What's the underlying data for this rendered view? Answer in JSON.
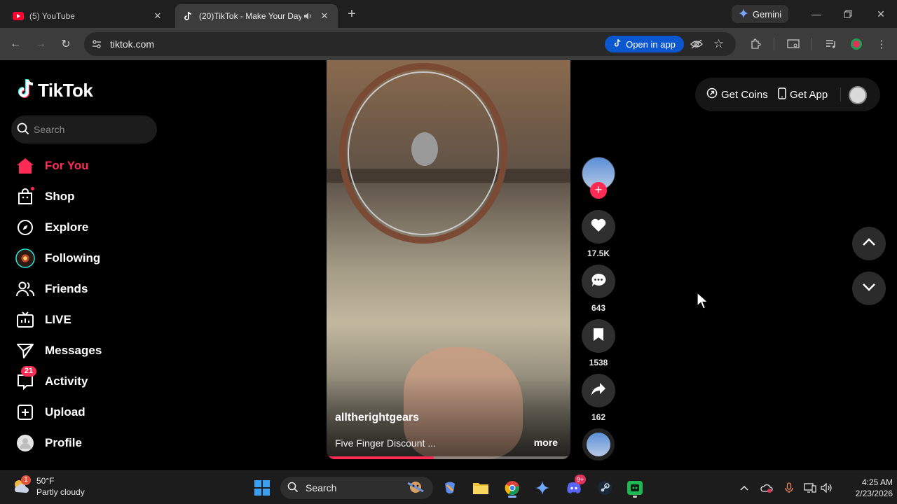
{
  "browser": {
    "tabs": [
      {
        "title": "(5) YouTube",
        "active": false,
        "icon": "youtube-icon"
      },
      {
        "title": "(20)TikTok - Make Your Day",
        "active": true,
        "icon": "tiktok-icon"
      }
    ],
    "gemini_label": "Gemini",
    "url": "tiktok.com",
    "open_in_app_label": "Open in app"
  },
  "tiktok": {
    "logo_text": "TikTok",
    "search_placeholder": "Search",
    "nav": [
      {
        "label": "For You",
        "icon": "home-icon",
        "active": true
      },
      {
        "label": "Shop",
        "icon": "shop-icon"
      },
      {
        "label": "Explore",
        "icon": "compass-icon"
      },
      {
        "label": "Following",
        "icon": "following-avatar-icon"
      },
      {
        "label": "Friends",
        "icon": "friends-icon"
      },
      {
        "label": "LIVE",
        "icon": "live-icon"
      },
      {
        "label": "Messages",
        "icon": "messages-icon"
      },
      {
        "label": "Activity",
        "icon": "activity-icon",
        "badge": "21"
      },
      {
        "label": "Upload",
        "icon": "upload-icon"
      },
      {
        "label": "Profile",
        "icon": "profile-icon"
      }
    ],
    "top_actions": {
      "get_coins": "Get Coins",
      "get_app": "Get App"
    },
    "video": {
      "author": "alltherightgears",
      "caption": "Five Finger Discount ...",
      "more_label": "more",
      "progress": 0.44
    },
    "actions": {
      "likes": "17.5K",
      "comments": "643",
      "saves": "1538",
      "shares": "162"
    }
  },
  "taskbar": {
    "weather_temp": "50°F",
    "weather_desc": "Partly cloudy",
    "weather_badge": "1",
    "search_label": "Search",
    "discord_badge": "9+",
    "time": "4:25 AM",
    "date": "2/23/2026"
  },
  "colors": {
    "accent": "#fe2c55",
    "chrome_blue": "#0b57d0"
  }
}
